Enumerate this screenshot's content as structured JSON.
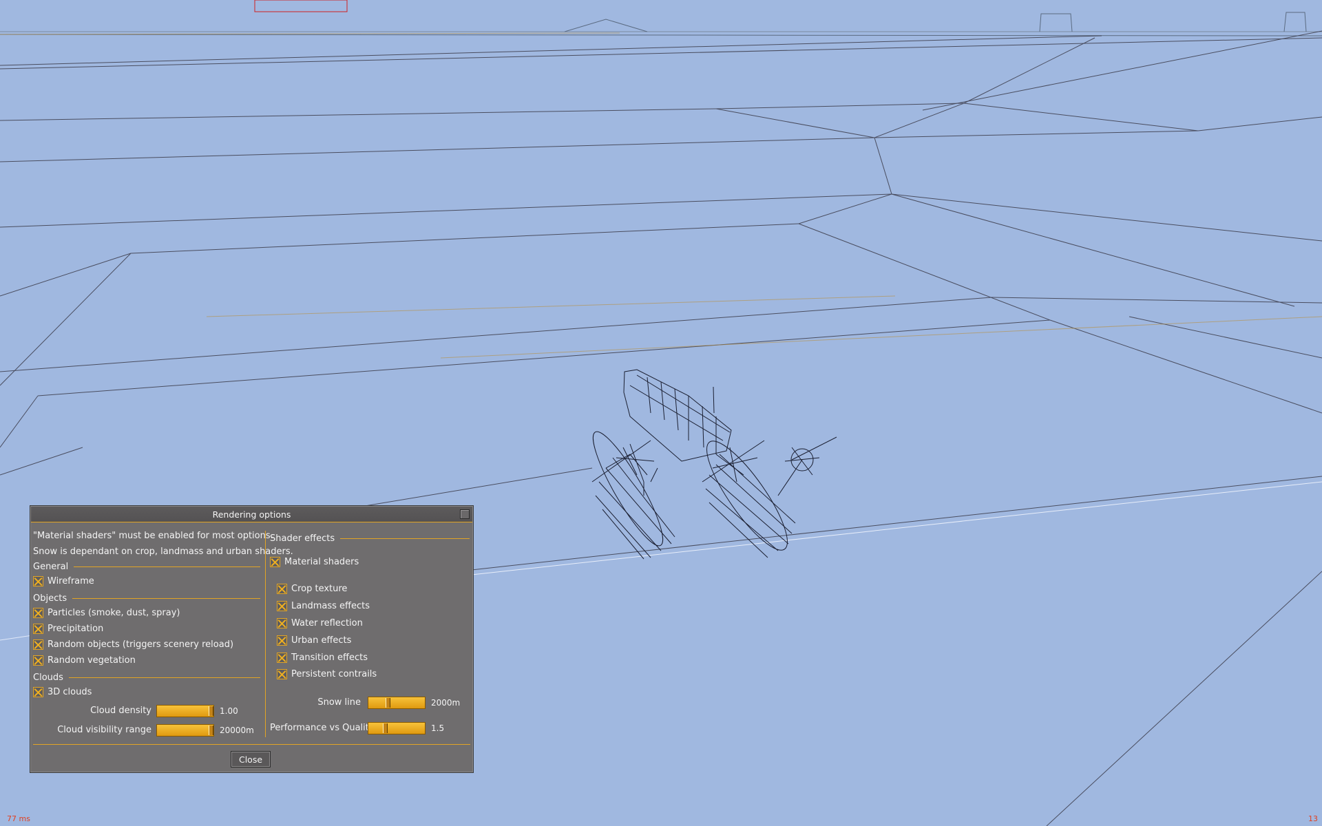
{
  "dialog": {
    "title": "Rendering options",
    "note1": "\"Material shaders\" must be enabled for most options.",
    "note2": "Snow is dependant on crop, landmass and urban shaders.",
    "left": {
      "general_label": "General",
      "wireframe": "Wireframe",
      "objects_label": "Objects",
      "particles": "Particles (smoke, dust, spray)",
      "precipitation": "Precipitation",
      "random_objects": "Random objects (triggers scenery reload)",
      "random_vegetation": "Random vegetation",
      "clouds_label": "Clouds",
      "clouds_3d": "3D clouds",
      "cloud_density_label": "Cloud density",
      "cloud_density_value": "1.00",
      "cloud_density_level": 1.0,
      "cloud_vis_label": "Cloud visibility range",
      "cloud_vis_value": "20000m",
      "cloud_vis_level": 1.0
    },
    "right": {
      "shader_effects_label": "Shader effects",
      "material_shaders": "Material shaders",
      "crop_texture": "Crop texture",
      "landmass_effects": "Landmass effects",
      "water_reflection": "Water reflection",
      "urban_effects": "Urban effects",
      "transition_effects": "Transition effects",
      "persistent_contrails": "Persistent contrails",
      "snow_line_label": "Snow line",
      "snow_line_value": "2000m",
      "snow_line_level": 0.35,
      "perf_label": "Performance vs Quality",
      "perf_value": "1.5",
      "perf_level": 0.3
    },
    "close_label": "Close"
  },
  "status": {
    "frame_time": "77 ms",
    "counter": "13"
  },
  "colors": {
    "sky": "#a0b8e0",
    "accent": "#e3a524",
    "panel": "#6f6d6e"
  }
}
